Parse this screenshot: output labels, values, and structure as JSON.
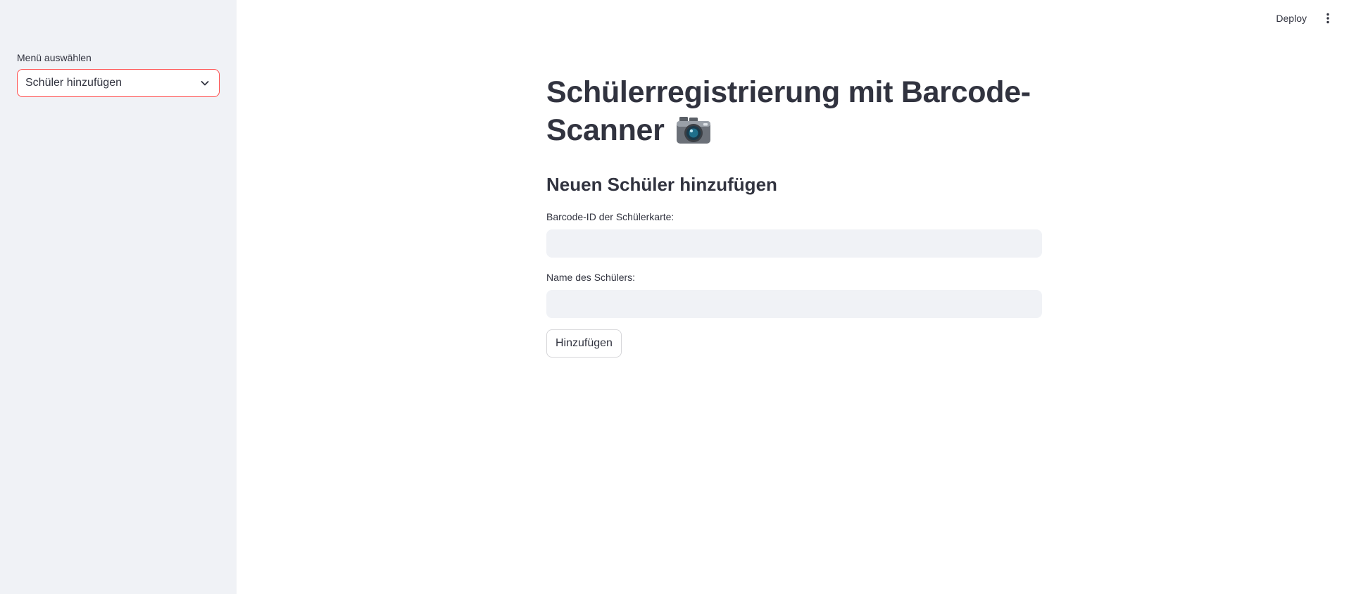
{
  "sidebar": {
    "menu_label": "Menü auswählen",
    "menu_selected": "Schüler hinzufügen"
  },
  "header": {
    "deploy_label": "Deploy"
  },
  "main": {
    "title": "Schülerregistrierung mit Barcode-Scanner",
    "subtitle": "Neuen Schüler hinzufügen",
    "barcode_label": "Barcode-ID der Schülerkarte:",
    "barcode_value": "",
    "name_label": "Name des Schülers:",
    "name_value": "",
    "add_button_label": "Hinzufügen"
  },
  "colors": {
    "accent": "#ff4b4b",
    "sidebar_bg": "#f0f2f6",
    "text": "#31333f"
  },
  "icons": {
    "select_chevron": "chevron-down-icon",
    "menu": "kebab-menu-icon",
    "title_emoji": "camera-icon"
  }
}
